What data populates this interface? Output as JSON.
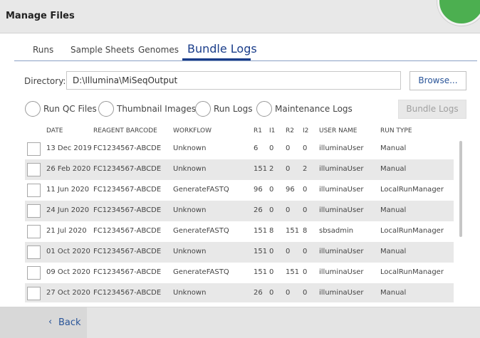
{
  "window": {
    "title": "Manage Files"
  },
  "tabs": [
    {
      "label": "Runs"
    },
    {
      "label": "Sample Sheets"
    },
    {
      "label": "Genomes"
    },
    {
      "label": "Bundle Logs",
      "active": true
    }
  ],
  "directory": {
    "label": "Directory:",
    "value": "D:\\Illumina\\MiSeqOutput",
    "browse_label": "Browse..."
  },
  "options": [
    {
      "label": "Run QC Files"
    },
    {
      "label": "Thumbnail Images"
    },
    {
      "label": "Run Logs"
    },
    {
      "label": "Maintenance Logs"
    }
  ],
  "bundle_button": {
    "label": "Bundle Logs"
  },
  "table": {
    "columns": [
      "DATE",
      "REAGENT BARCODE",
      "WORKFLOW",
      "R1",
      "I1",
      "R2",
      "I2",
      "USER NAME",
      "RUN TYPE"
    ],
    "rows": [
      [
        "13 Dec 2019",
        "FC1234567-ABCDE",
        "Unknown",
        "6",
        "0",
        "0",
        "0",
        "illuminaUser",
        "Manual"
      ],
      [
        "26 Feb 2020",
        "FC1234567-ABCDE",
        "Unknown",
        "151",
        "2",
        "0",
        "2",
        "illuminaUser",
        "Manual"
      ],
      [
        "11 Jun 2020",
        "FC1234567-ABCDE",
        "GenerateFASTQ",
        "96",
        "0",
        "96",
        "0",
        "illuminaUser",
        "LocalRunManager"
      ],
      [
        "24 Jun 2020",
        "FC1234567-ABCDE",
        "Unknown",
        "26",
        "0",
        "0",
        "0",
        "illuminaUser",
        "Manual"
      ],
      [
        "21 Jul 2020",
        "FC1234567-ABCDE",
        "GenerateFASTQ",
        "151",
        "8",
        "151",
        "8",
        "sbsadmin",
        "LocalRunManager"
      ],
      [
        "01 Oct 2020",
        "FC1234567-ABCDE",
        "Unknown",
        "151",
        "0",
        "0",
        "0",
        "illuminaUser",
        "Manual"
      ],
      [
        "09 Oct 2020",
        "FC1234567-ABCDE",
        "GenerateFASTQ",
        "151",
        "0",
        "151",
        "0",
        "illuminaUser",
        "LocalRunManager"
      ],
      [
        "27 Oct 2020",
        "FC1234567-ABCDE",
        "Unknown",
        "26",
        "0",
        "0",
        "0",
        "illuminaUser",
        "Manual"
      ]
    ]
  },
  "footer": {
    "back_label": "Back",
    "back_icon": "chevron-left-icon"
  },
  "colors": {
    "accent": "#1a3d8a",
    "link": "#2a5599",
    "status_green": "#4caf50"
  }
}
